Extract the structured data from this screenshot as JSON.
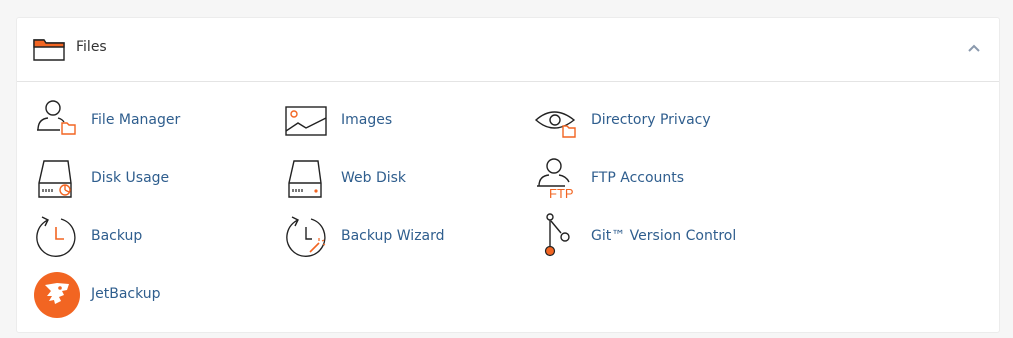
{
  "section": {
    "title": "Files",
    "colors": {
      "accent": "#f26522",
      "link": "#2f5e8e",
      "icon_stroke": "#222222"
    },
    "icons": {
      "header": "folder-icon",
      "collapse": "chevron-up-icon"
    },
    "items": [
      {
        "label": "File Manager",
        "icon": "file-manager-icon"
      },
      {
        "label": "Images",
        "icon": "images-icon"
      },
      {
        "label": "Directory Privacy",
        "icon": "directory-privacy-icon"
      },
      {
        "label": "Disk Usage",
        "icon": "disk-usage-icon"
      },
      {
        "label": "Web Disk",
        "icon": "web-disk-icon"
      },
      {
        "label": "FTP Accounts",
        "icon": "ftp-accounts-icon",
        "icon_text": "FTP"
      },
      {
        "label": "Backup",
        "icon": "backup-icon"
      },
      {
        "label": "Backup Wizard",
        "icon": "backup-wizard-icon"
      },
      {
        "label": "Git™ Version Control",
        "icon": "git-icon"
      },
      {
        "label": "JetBackup",
        "icon": "jetbackup-icon"
      }
    ]
  }
}
